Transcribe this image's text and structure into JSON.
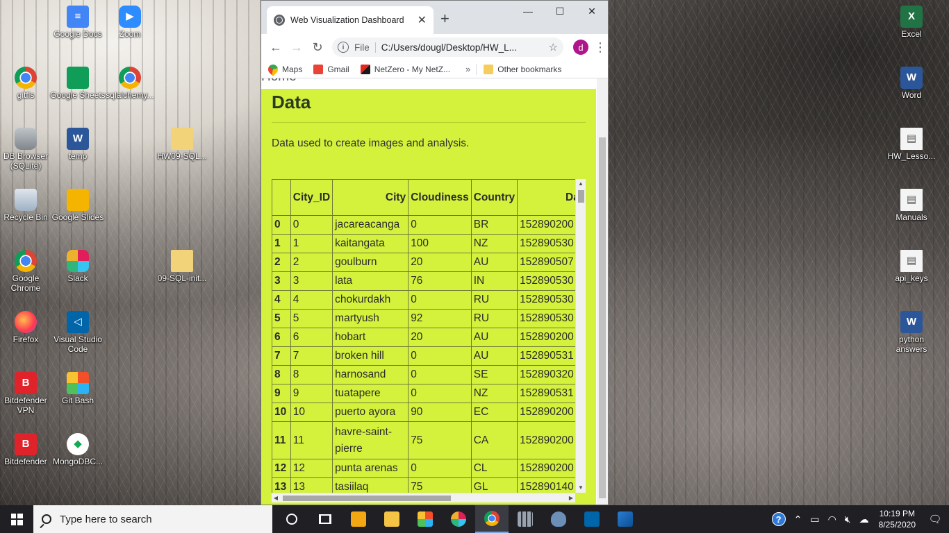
{
  "desktop": {
    "icons": [
      {
        "label": "Google Docs",
        "glyph": "doc"
      },
      {
        "label": "Zoom",
        "glyph": "zoom"
      },
      {
        "label": "gitfls",
        "glyph": "chrome"
      },
      {
        "label": "Google Sheets",
        "glyph": "sheets"
      },
      {
        "label": "sqlalchemy...",
        "glyph": "chrome"
      },
      {
        "label": "DB Browser (SQLite)",
        "glyph": "db"
      },
      {
        "label": "temp",
        "glyph": "word"
      },
      {
        "label": "HW09-SQL...",
        "glyph": "folder"
      },
      {
        "label": "Recycle Bin",
        "glyph": "bin"
      },
      {
        "label": "Google Slides",
        "glyph": "slides"
      },
      {
        "label": "Google Chrome",
        "glyph": "chrome"
      },
      {
        "label": "Slack",
        "glyph": "slack"
      },
      {
        "label": "09-SQL-init...",
        "glyph": "folder"
      },
      {
        "label": "Firefox",
        "glyph": "firefox"
      },
      {
        "label": "Visual Studio Code",
        "glyph": "vscode"
      },
      {
        "label": "Bitdefender VPN",
        "glyph": "bd"
      },
      {
        "label": "Git Bash",
        "glyph": "git"
      },
      {
        "label": "Bitdefender",
        "glyph": "bd"
      },
      {
        "label": "MongoDBC...",
        "glyph": "mongo"
      },
      {
        "label": "Excel",
        "glyph": "excel"
      },
      {
        "label": "Word",
        "glyph": "word"
      },
      {
        "label": "HW_Lesso...",
        "glyph": "file"
      },
      {
        "label": "Manuals",
        "glyph": "file"
      },
      {
        "label": "api_keys",
        "glyph": "file"
      },
      {
        "label": "python answers",
        "glyph": "word"
      }
    ]
  },
  "browser": {
    "tab_title": "Web Visualization Dashboard",
    "tab_close": "✕",
    "new_tab": "+",
    "window_controls": {
      "minimize": "—",
      "maximize": "☐",
      "close": "✕"
    },
    "nav": {
      "back": "←",
      "forward": "→",
      "reload": "↻"
    },
    "address": {
      "scheme": "File",
      "url": "C:/Users/dougl/Desktop/HW_L..."
    },
    "profile_initial": "d",
    "bookmarks": [
      {
        "label": "Maps",
        "icon": "maps"
      },
      {
        "label": "Gmail",
        "icon": "gmail"
      },
      {
        "label": "NetZero - My NetZ...",
        "icon": "netzero"
      }
    ],
    "bookmarks_overflow": "»",
    "other_bookmarks": "Other bookmarks"
  },
  "page": {
    "nav_home": "Home",
    "heading": "Data",
    "description": "Data used to create images and analysis.",
    "table": {
      "columns": [
        "",
        "City_ID",
        "City",
        "Cloudiness",
        "Country",
        "Dat"
      ],
      "rows": [
        [
          "0",
          "0",
          "jacareacanga",
          "0",
          "BR",
          "152890200"
        ],
        [
          "1",
          "1",
          "kaitangata",
          "100",
          "NZ",
          "152890530"
        ],
        [
          "2",
          "2",
          "goulburn",
          "20",
          "AU",
          "152890507"
        ],
        [
          "3",
          "3",
          "lata",
          "76",
          "IN",
          "152890530"
        ],
        [
          "4",
          "4",
          "chokurdakh",
          "0",
          "RU",
          "152890530"
        ],
        [
          "5",
          "5",
          "martyush",
          "92",
          "RU",
          "152890530"
        ],
        [
          "6",
          "6",
          "hobart",
          "20",
          "AU",
          "152890200"
        ],
        [
          "7",
          "7",
          "broken hill",
          "0",
          "AU",
          "152890531"
        ],
        [
          "8",
          "8",
          "harnosand",
          "0",
          "SE",
          "152890320"
        ],
        [
          "9",
          "9",
          "tuatapere",
          "0",
          "NZ",
          "152890531"
        ],
        [
          "10",
          "10",
          "puerto ayora",
          "90",
          "EC",
          "152890200"
        ],
        [
          "11",
          "11",
          "havre-saint-pierre",
          "75",
          "CA",
          "152890200"
        ],
        [
          "12",
          "12",
          "punta arenas",
          "0",
          "CL",
          "152890200"
        ],
        [
          "13",
          "13",
          "tasiilaq",
          "75",
          "GL",
          "152890140"
        ]
      ]
    }
  },
  "taskbar": {
    "search_placeholder": "Type here to search",
    "time": "10:19 PM",
    "date": "8/25/2020",
    "help": "?"
  }
}
